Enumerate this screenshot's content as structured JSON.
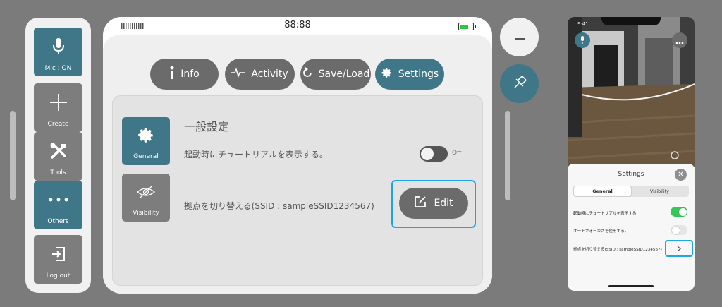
{
  "left_panel": {
    "tools": [
      {
        "label": "Mic : ON",
        "icon": "microphone-icon"
      },
      {
        "label": "Create",
        "icon": "plus-icon"
      },
      {
        "label": "Tools",
        "icon": "tools-icon"
      },
      {
        "label": "Others",
        "icon": "ellipsis-icon"
      },
      {
        "label": "Log out",
        "icon": "logout-icon"
      }
    ]
  },
  "tablet": {
    "time": "88:88",
    "battery_level": 0.7,
    "tabs": [
      {
        "label": "Info",
        "icon": "info-icon"
      },
      {
        "label": "Activity",
        "icon": "activity-icon"
      },
      {
        "label": "Save/Load",
        "icon": "refresh-icon"
      },
      {
        "label": "Settings",
        "icon": "gear-icon",
        "active": true
      }
    ],
    "side_tabs": [
      {
        "label": "General",
        "icon": "gear-icon",
        "active": true
      },
      {
        "label": "Visibility",
        "icon": "eye-slash-icon"
      }
    ],
    "settings": {
      "section_title": "一般設定",
      "tutorial_label": "起動時にチュートリアルを表示する。",
      "tutorial_toggle_state": "Off",
      "base_label": "拠点を切り替える(SSID : sampleSSID1234567)",
      "edit_label": "Edit"
    }
  },
  "circle_buttons": [
    {
      "icon": "minus-icon"
    },
    {
      "icon": "pin-icon"
    }
  ],
  "phone": {
    "time": "9:41",
    "sheet": {
      "title": "Settings",
      "tabs": [
        "General",
        "Visibility"
      ],
      "selected_tab": "General",
      "rows": [
        {
          "label": "起動時にチュートリアルを表示する",
          "control": "toggle",
          "on": true
        },
        {
          "label": "オートフォーカスを使用する。",
          "control": "toggle",
          "on": false
        },
        {
          "label": "拠点を切り替える(SSID : sampleSSID1234567)",
          "control": "chevron"
        }
      ]
    }
  },
  "colors": {
    "teal": "#3f7788",
    "gray_button": "#6b6b6b",
    "highlight": "#1ea5e6",
    "toggle_on": "#34c759",
    "background": "#7b7b7b"
  }
}
